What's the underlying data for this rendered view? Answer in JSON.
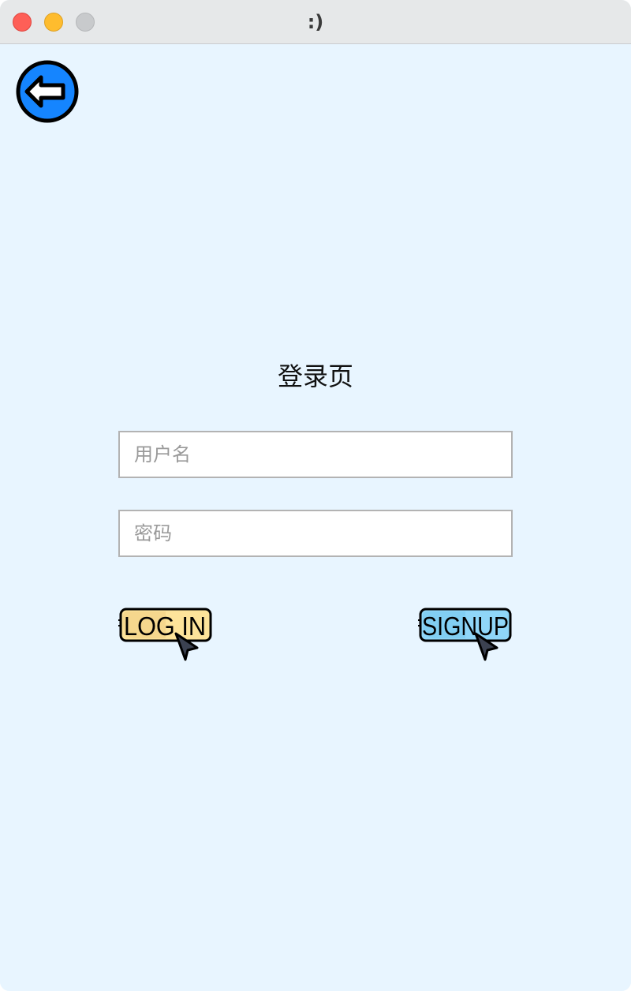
{
  "window": {
    "title": ":)"
  },
  "page": {
    "title": "登录页"
  },
  "form": {
    "username_placeholder": "用户名",
    "password_placeholder": "密码"
  },
  "buttons": {
    "login_label": "LOG IN",
    "signup_label": "SIGNUP"
  },
  "icons": {
    "back": "back-arrow-circle-icon",
    "cursor": "mouse-pointer-icon"
  },
  "colors": {
    "background": "#e8f5ff",
    "back_button": "#1585ff",
    "login_fill": "#fde39a",
    "signup_fill": "#8fd6f8"
  }
}
